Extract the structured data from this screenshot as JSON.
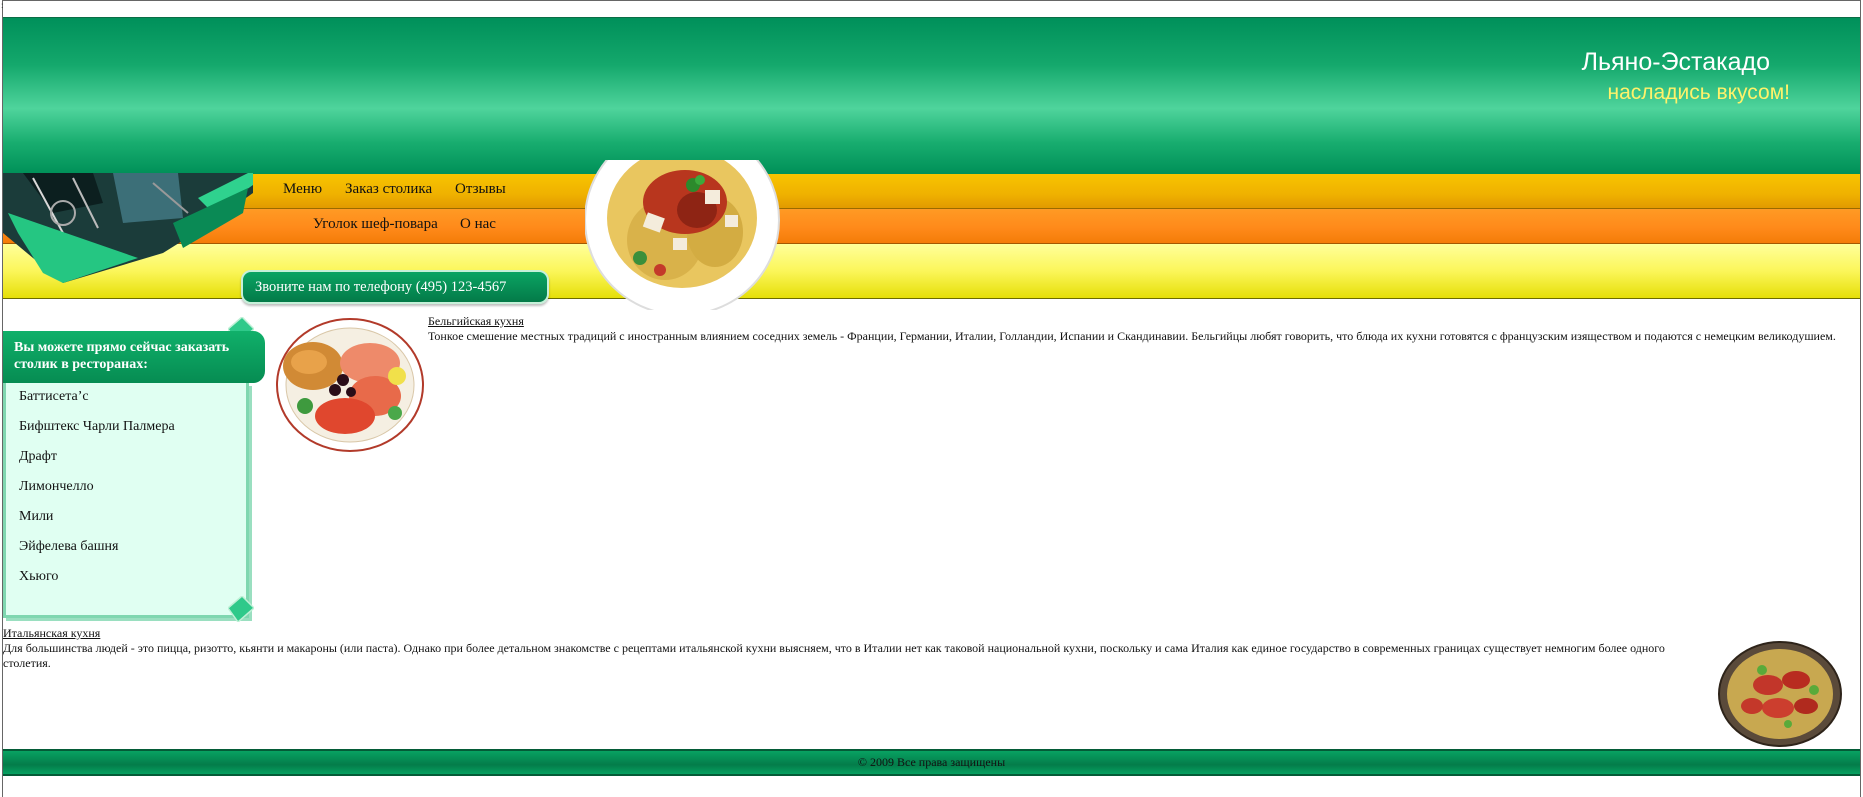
{
  "header": {
    "site_title": "Льяно-Эстакадо",
    "tagline": "насладись вкусом!"
  },
  "nav": {
    "row1": [
      "Меню",
      "Заказ столика",
      "Отзывы"
    ],
    "row2": [
      "Уголок шеф-повара",
      "О нас"
    ]
  },
  "phone": {
    "label": "Звоните нам по телефону (495) 123-4567"
  },
  "sidebar": {
    "heading": "Вы можете прямо сейчас заказать столик в ресторанах:",
    "items": [
      "Баттисета’с",
      "Бифштекс Чарли Палмера",
      "Драфт",
      "Лимончелло",
      "Мили",
      "Эйфелева башня",
      "Хьюго"
    ]
  },
  "articles": [
    {
      "title": "Бельгийская кухня",
      "text": "Тонкое смешение местных традиций с иностранным влиянием соседних земель - Франции, Германии, Италии, Голландии, Испании и Скандинавии. Бельгийцы любят говорить, что блюда их кухни готовятся с французским изяществом и подаются с немецким великодушием."
    },
    {
      "title": "Итальянская кухня",
      "text": "Для большинства людей - это пицца, ризотто, кьянти и макароны (или паста). Однако при более детальном знакомстве с рецептами итальянской кухни выясняем, что в Италии нет как таковой национальной кухни, поскольку и сама Италия как единое государство в современных границах существует немногим более одного столетия."
    }
  ],
  "footer": {
    "copyright": "© 2009 Все права защищены"
  },
  "colors": {
    "header_green": "#0a9a5e",
    "gold_band": "#f0b400",
    "orange_band": "#ff8c1c",
    "yellow_band": "#f7f250",
    "tagline_yellow": "#fff26a",
    "sidebar_bg": "#e0fff2"
  }
}
